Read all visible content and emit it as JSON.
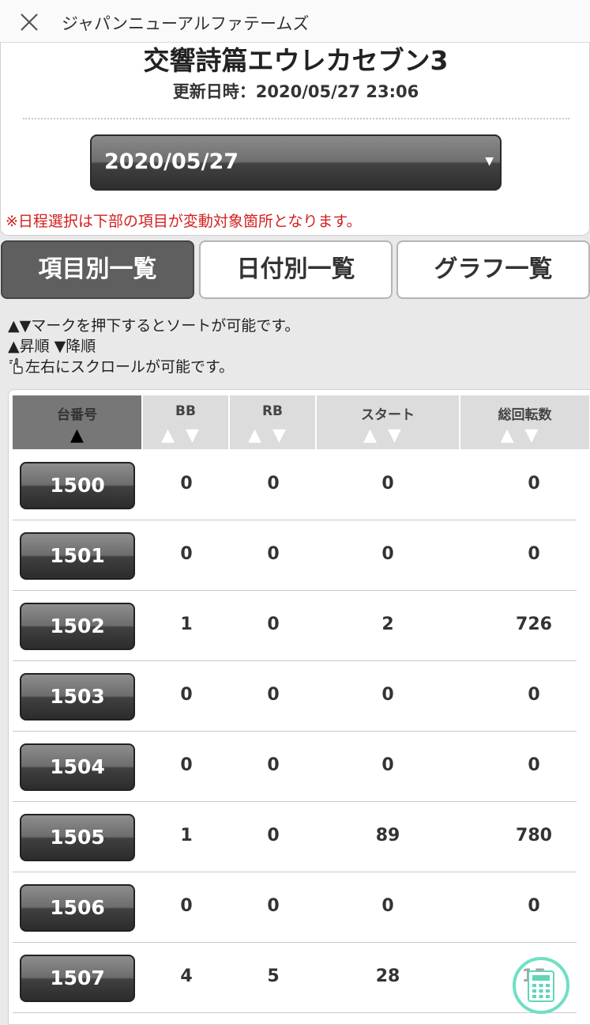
{
  "app": {
    "title": "ジャパンニューアルファテームズ"
  },
  "header": {
    "machine_name": "交響詩篇エウレカセブン3",
    "updated": "更新日時：2020/05/27 23:06",
    "date_value": "2020/05/27",
    "note": "※日程選択は下部の項目が変動対象箇所となります。"
  },
  "tabs": [
    {
      "label": "項目別一覧",
      "active": true
    },
    {
      "label": "日付別一覧",
      "active": false
    },
    {
      "label": "グラフ一覧",
      "active": false
    }
  ],
  "hints": {
    "line1": "▲▼マークを押下するとソートが可能です。",
    "line2": "▲昇順 ▼降順",
    "line3": "左右にスクロールが可能です。"
  },
  "table": {
    "columns": [
      "台番号",
      "BB",
      "RB",
      "スタート",
      "総回転数"
    ],
    "rows": [
      {
        "no": "1500",
        "bb": "0",
        "rb": "0",
        "start": "0",
        "total": "0"
      },
      {
        "no": "1501",
        "bb": "0",
        "rb": "0",
        "start": "0",
        "total": "0"
      },
      {
        "no": "1502",
        "bb": "1",
        "rb": "0",
        "start": "2",
        "total": "726"
      },
      {
        "no": "1503",
        "bb": "0",
        "rb": "0",
        "start": "0",
        "total": "0"
      },
      {
        "no": "1504",
        "bb": "0",
        "rb": "0",
        "start": "0",
        "total": "0"
      },
      {
        "no": "1505",
        "bb": "1",
        "rb": "0",
        "start": "89",
        "total": "780"
      },
      {
        "no": "1506",
        "bb": "0",
        "rb": "0",
        "start": "0",
        "total": "0"
      },
      {
        "no": "1507",
        "bb": "4",
        "rb": "5",
        "start": "28",
        "total": "15"
      }
    ]
  },
  "colors": {
    "accent_red": "#d32020",
    "calc_ring": "#6ee0c4"
  }
}
